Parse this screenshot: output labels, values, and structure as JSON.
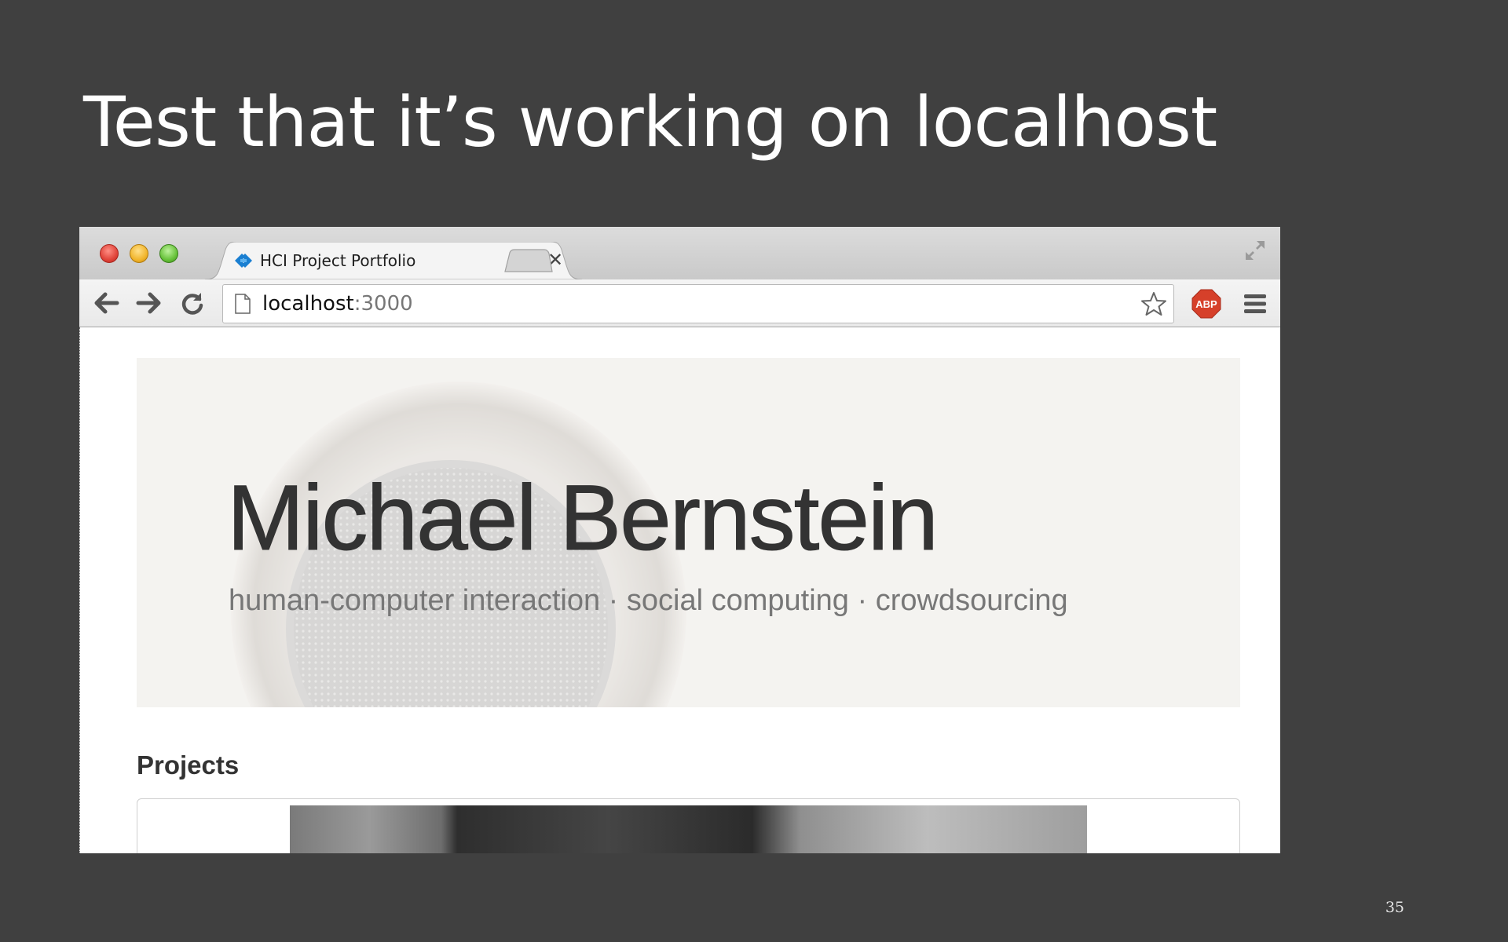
{
  "slide": {
    "title": "Test that it’s working on localhost",
    "number": "35"
  },
  "browser": {
    "tab": {
      "title": "HCI Project Portfolio",
      "close_glyph": "✕"
    },
    "address": {
      "host": "localhost",
      "port": ":3000"
    },
    "extension_badge": "ABP"
  },
  "page": {
    "hero": {
      "name": "Michael Bernstein",
      "tagline": "human-computer interaction · social computing · crowdsourcing"
    },
    "projects_heading": "Projects"
  },
  "colors": {
    "slide_background": "#404040",
    "abp_badge": "#d6402a",
    "hero_background": "#f3f2ef",
    "favicon_blue": "#1a7fd1"
  }
}
